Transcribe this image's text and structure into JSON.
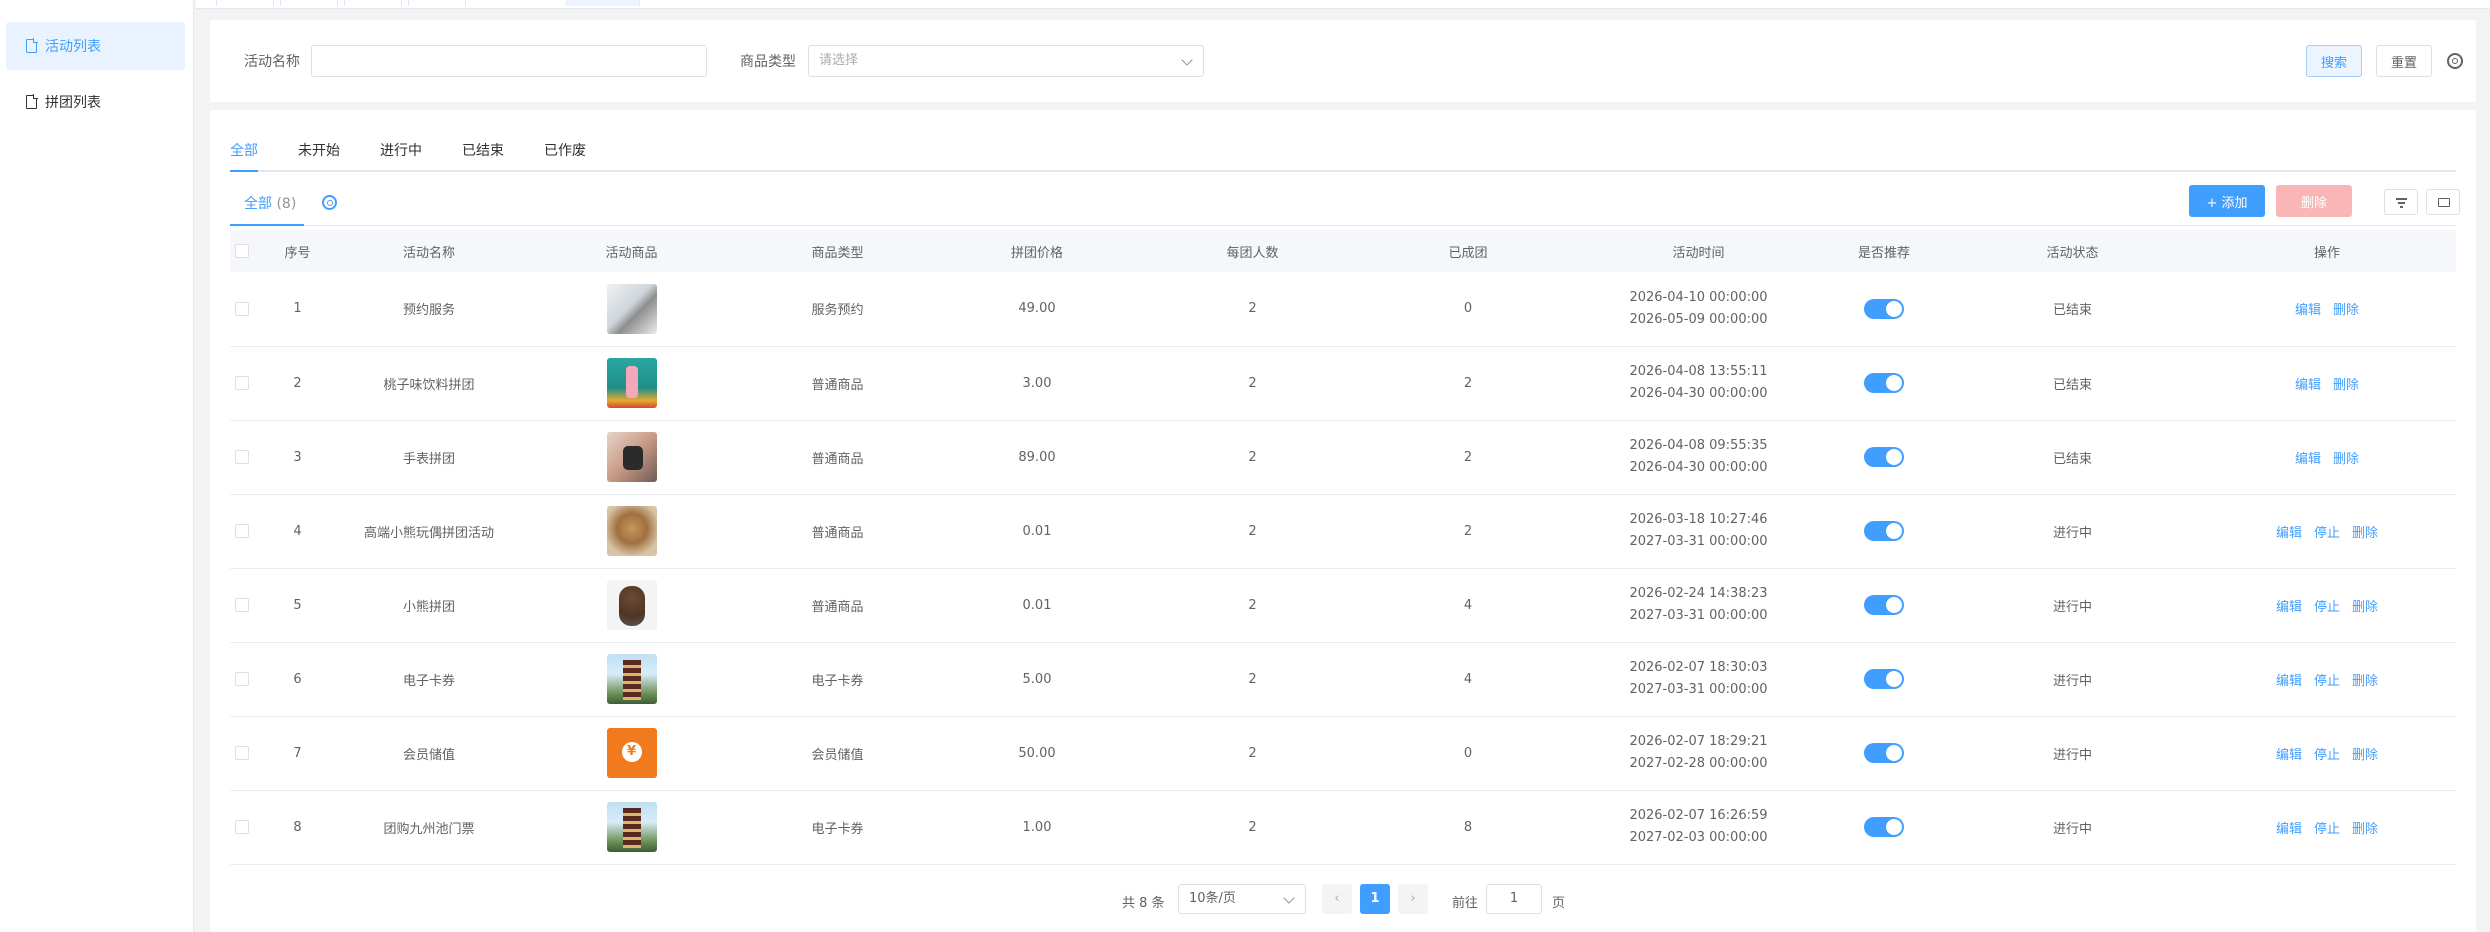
{
  "sidebar": {
    "items": [
      {
        "label": "活动列表",
        "active": true
      },
      {
        "label": "拼团列表",
        "active": false
      }
    ]
  },
  "search": {
    "name_label": "活动名称",
    "name_value": "",
    "type_label": "商品类型",
    "type_placeholder": "请选择",
    "search_btn": "搜索",
    "reset_btn": "重置",
    "settings_icon": "gear-icon"
  },
  "tabs": [
    "全部",
    "未开始",
    "进行中",
    "已结束",
    "已作废"
  ],
  "subtab": {
    "label": "全部",
    "count": "(8)"
  },
  "toolbar": {
    "add_label": "+ 添加",
    "delete_label": "删除"
  },
  "table": {
    "headers": [
      "序号",
      "活动名称",
      "活动商品",
      "商品类型",
      "拼团价格",
      "每团人数",
      "已成团",
      "活动时间",
      "是否推荐",
      "活动状态",
      "操作"
    ],
    "rows": [
      {
        "no": "1",
        "name": "预约服务",
        "type": "服务预约",
        "price": "49.00",
        "size": "2",
        "formed": "0",
        "start": "2026-04-10 00:00:00",
        "end": "2026-05-09 00:00:00",
        "recommend": true,
        "status": "已结束",
        "ops": [
          "编辑",
          "删除"
        ]
      },
      {
        "no": "2",
        "name": "桃子味饮料拼团",
        "type": "普通商品",
        "price": "3.00",
        "size": "2",
        "formed": "2",
        "start": "2026-04-08 13:55:11",
        "end": "2026-04-30 00:00:00",
        "recommend": true,
        "status": "已结束",
        "ops": [
          "编辑",
          "删除"
        ]
      },
      {
        "no": "3",
        "name": "手表拼团",
        "type": "普通商品",
        "price": "89.00",
        "size": "2",
        "formed": "2",
        "start": "2026-04-08 09:55:35",
        "end": "2026-04-30 00:00:00",
        "recommend": true,
        "status": "已结束",
        "ops": [
          "编辑",
          "删除"
        ]
      },
      {
        "no": "4",
        "name": "高端小熊玩偶拼团活动",
        "type": "普通商品",
        "price": "0.01",
        "size": "2",
        "formed": "2",
        "start": "2026-03-18 10:27:46",
        "end": "2027-03-31 00:00:00",
        "recommend": true,
        "status": "进行中",
        "ops": [
          "编辑",
          "停止",
          "删除"
        ]
      },
      {
        "no": "5",
        "name": "小熊拼团",
        "type": "普通商品",
        "price": "0.01",
        "size": "2",
        "formed": "4",
        "start": "2026-02-24 14:38:23",
        "end": "2027-03-31 00:00:00",
        "recommend": true,
        "status": "进行中",
        "ops": [
          "编辑",
          "停止",
          "删除"
        ]
      },
      {
        "no": "6",
        "name": "电子卡券",
        "type": "电子卡券",
        "price": "5.00",
        "size": "2",
        "formed": "4",
        "start": "2026-02-07 18:30:03",
        "end": "2027-03-31 00:00:00",
        "recommend": true,
        "status": "进行中",
        "ops": [
          "编辑",
          "停止",
          "删除"
        ]
      },
      {
        "no": "7",
        "name": "会员储值",
        "type": "会员储值",
        "price": "50.00",
        "size": "2",
        "formed": "0",
        "start": "2026-02-07 18:29:21",
        "end": "2027-02-28 00:00:00",
        "recommend": true,
        "status": "进行中",
        "ops": [
          "编辑",
          "停止",
          "删除"
        ]
      },
      {
        "no": "8",
        "name": "团购九州池门票",
        "type": "电子卡券",
        "price": "1.00",
        "size": "2",
        "formed": "8",
        "start": "2026-02-07 16:26:59",
        "end": "2027-02-03 00:00:00",
        "recommend": true,
        "status": "进行中",
        "ops": [
          "编辑",
          "停止",
          "删除"
        ]
      }
    ]
  },
  "pagination": {
    "total": "共 8 条",
    "page_size": "10条/页",
    "current": "1",
    "prev": "‹",
    "next": "›",
    "goto_label": "前往",
    "goto_value": "1",
    "page_suffix": "页"
  },
  "colors": {
    "primary": "#409eff",
    "danger_disabled": "#fab6b6"
  }
}
